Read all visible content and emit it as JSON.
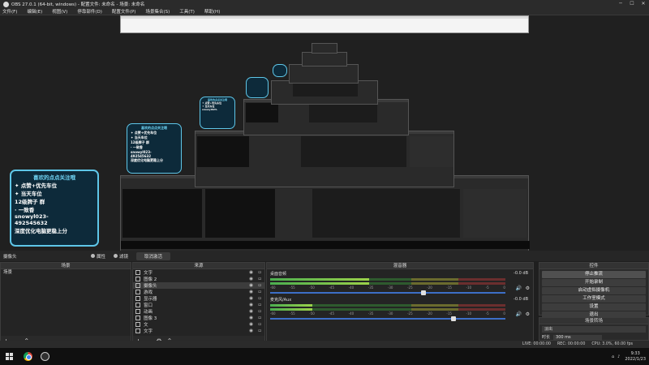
{
  "window": {
    "title": "OBS 27.0.1 (64-bit, windows) - 配置文件: 未命名 - 场景: 未命名"
  },
  "menu": [
    "文件(F)",
    "编辑(E)",
    "视图(V)",
    "停靠部件(D)",
    "配置文件(P)",
    "场景集合(S)",
    "工具(T)",
    "帮助(H)"
  ],
  "overlay": {
    "heading": "喜欢的点点关注哦",
    "lines": [
      "✦ 点赞+优先车位",
      "✦ 当天车位",
      "12级牌子 群",
      "· 一致香",
      "snowyl023-",
      "492545632",
      "深度优化电脑更稳上分"
    ]
  },
  "source_bar": {
    "label": "摄像头",
    "props": "属性",
    "filters": "滤镜",
    "interact": "取消激活"
  },
  "scenes": {
    "header": "场景",
    "items": [
      "场景"
    ]
  },
  "sources": {
    "header": "来源",
    "items": [
      "文字",
      "图像 2",
      "摄像头",
      "游戏",
      "显示器",
      "窗口",
      "动画",
      "图像 3",
      "文",
      "文字"
    ]
  },
  "mixer": {
    "header": "混音器",
    "channels": [
      {
        "name": "桌面音频",
        "db": "-0.0 dB",
        "level": 0.42,
        "volume": 0.65
      },
      {
        "name": "麦克风/Aux",
        "db": "-0.0 dB",
        "level": 0.18,
        "volume": 0.78
      }
    ],
    "scale": [
      "-60",
      "-55",
      "-50",
      "-45",
      "-40",
      "-35",
      "-30",
      "-25",
      "-20",
      "-15",
      "-10",
      "-5",
      "0"
    ]
  },
  "controls": {
    "header": "控件",
    "buttons": [
      "停止推流",
      "开始录制",
      "启动虚拟摄像机",
      "工作室模式",
      "设置",
      "退出"
    ]
  },
  "transitions": {
    "header": "场景转场",
    "selected": "淡出",
    "duration_label": "时长",
    "duration": "300 ms"
  },
  "status": {
    "live": "LIVE: 00:00:00",
    "rec": "REC: 00:00:00",
    "cpu": "CPU: 3.0%, 60.00 fps"
  },
  "clock": {
    "time": "9:33",
    "date": "2022/1/23"
  }
}
